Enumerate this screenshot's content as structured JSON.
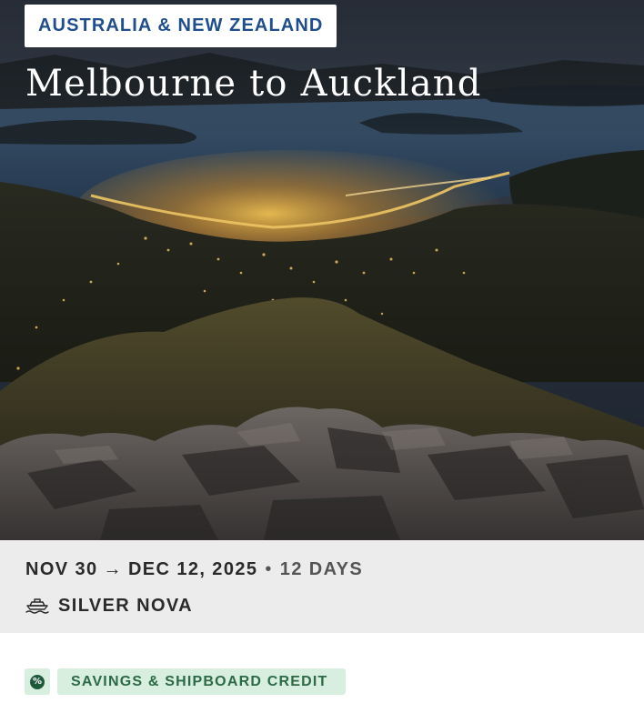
{
  "hero": {
    "region": "AUSTRALIA & NEW ZEALAND",
    "title": "Melbourne to Auckland",
    "image_description_icon": "harbor-night-photo"
  },
  "itinerary": {
    "start_date": "NOV 30",
    "arrow": "→",
    "end_date": "DEC 12, 2025",
    "separator": "•",
    "duration": "12 DAYS",
    "ship_icon": "ship-icon",
    "ship_name": "SILVER NOVA"
  },
  "offer": {
    "icon": "percent-discount-icon",
    "icon_glyph": "%",
    "label": "SAVINGS & SHIPBOARD CREDIT"
  },
  "colors": {
    "region_text": "#1f4e8c",
    "info_bar_bg": "#ececec",
    "offer_bg": "#d8efe0",
    "offer_text": "#2b6a45",
    "offer_icon": "#1e5a3a"
  }
}
